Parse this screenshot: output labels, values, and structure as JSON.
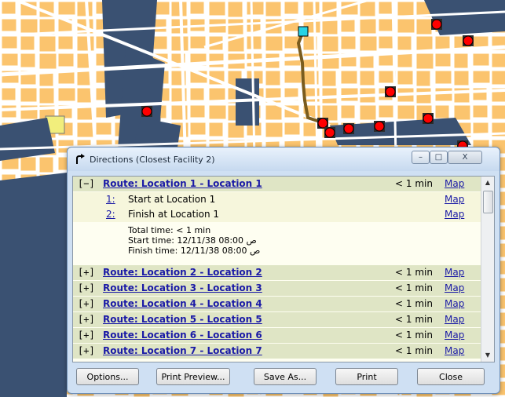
{
  "window": {
    "title": "Directions (Closest Facility 2)"
  },
  "window_buttons": {
    "minimize": "–",
    "maximize": "□",
    "close": "X"
  },
  "expanded_route": {
    "toggle": "[−]",
    "label": "Route: Location 1 - Location 1",
    "duration": "< 1 min",
    "map": "Map",
    "steps": [
      {
        "num": "1:",
        "text": "Start at Location 1",
        "map": "Map"
      },
      {
        "num": "2:",
        "text": "Finish at Location 1",
        "map": "Map"
      }
    ],
    "total_time": "Total time: < 1 min",
    "start_time": "Start time: 12/11/38 08:00 ص",
    "finish_time": "Finish time: 12/11/38 08:00 ص"
  },
  "collapsed_routes": [
    {
      "toggle": "[+]",
      "label": "Route: Location 2 - Location 2",
      "duration": "< 1 min",
      "map": "Map"
    },
    {
      "toggle": "[+]",
      "label": "Route: Location 3 - Location 3",
      "duration": "< 1 min",
      "map": "Map"
    },
    {
      "toggle": "[+]",
      "label": "Route: Location 4 - Location 4",
      "duration": "< 1 min",
      "map": "Map"
    },
    {
      "toggle": "[+]",
      "label": "Route: Location 5 - Location 5",
      "duration": "< 1 min",
      "map": "Map"
    },
    {
      "toggle": "[+]",
      "label": "Route: Location 6 - Location 6",
      "duration": "< 1 min",
      "map": "Map"
    },
    {
      "toggle": "[+]",
      "label": "Route: Location 7 - Location 7",
      "duration": "< 1 min",
      "map": "Map"
    }
  ],
  "buttons": {
    "options": "Options...",
    "print_preview": "Print Preview...",
    "save_as": "Save As...",
    "print": "Print",
    "close": "Close"
  },
  "colors": {
    "parcel": "#fbc46e",
    "water": "#3a5172",
    "road": "#ffffff",
    "route": "#7a5c1e",
    "facility": "#ff0000",
    "incident": "#27d3e6",
    "highlight_parcel": "#f1ee7c"
  }
}
